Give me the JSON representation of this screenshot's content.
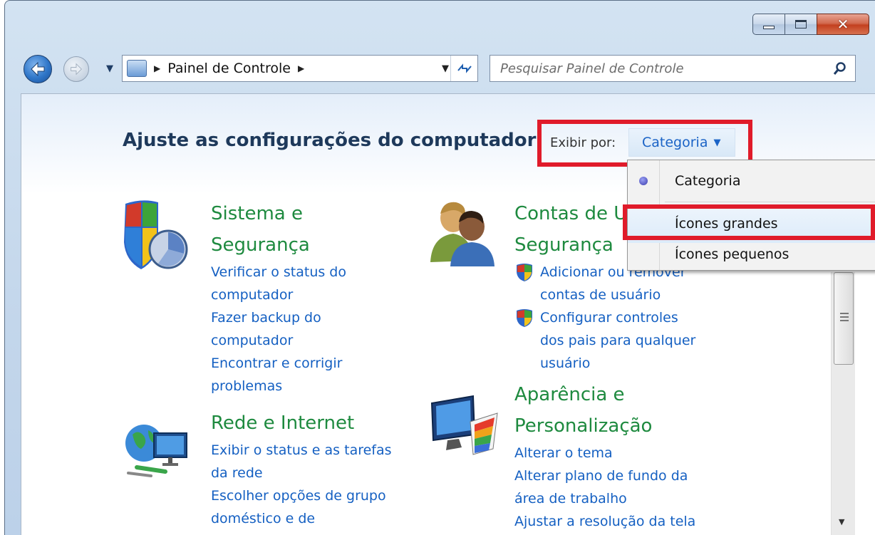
{
  "window": {
    "minimize_glyph": "",
    "close_glyph": "✕"
  },
  "nav": {
    "breadcrumb": "Painel de Controle",
    "search_placeholder": "Pesquisar Painel de Controle"
  },
  "header": {
    "title": "Ajuste as configurações do computador",
    "view_by_label": "Exibir por:",
    "view_by_value": "Categoria"
  },
  "menu": {
    "items": [
      {
        "label": "Categoria",
        "selected": true
      },
      {
        "label": "Ícones grandes",
        "selected": false
      },
      {
        "label": "Ícones pequenos",
        "selected": false
      }
    ]
  },
  "categories": {
    "system": {
      "title_line1": "Sistema e",
      "title_line2": "Segurança",
      "links": [
        "Verificar o status do",
        "computador",
        "Fazer backup do",
        "computador",
        "Encontrar e corrigir",
        "problemas"
      ]
    },
    "network": {
      "title": "Rede e Internet",
      "links": [
        "Exibir o status e as tarefas",
        "da rede",
        "Escolher opções de grupo",
        "doméstico e de"
      ]
    },
    "accounts": {
      "title_line1": "Contas de U",
      "title_line2": "Segurança",
      "links": [
        "Adicionar ou remover",
        "contas de usuário",
        "Configurar controles",
        "dos pais para qualquer",
        "usuário"
      ]
    },
    "appearance": {
      "title_line1": "Aparência e",
      "title_line2": "Personalização",
      "links": [
        "Alterar o tema",
        "Alterar plano de fundo da",
        "área de trabalho",
        "Ajustar a resolução da tela"
      ]
    }
  },
  "colors": {
    "highlight": "#e01b2a",
    "category_title": "#1e8a3f",
    "link": "#1560c2",
    "title": "#1e395b"
  }
}
